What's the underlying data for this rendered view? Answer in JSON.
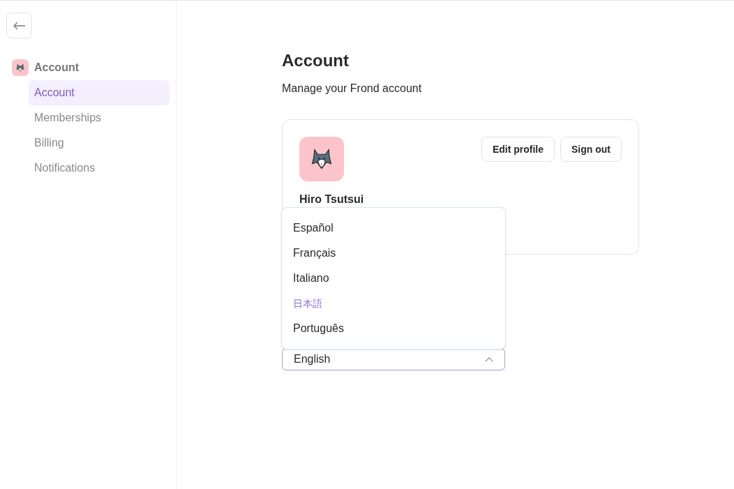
{
  "sidebar": {
    "group": {
      "label": "Account"
    },
    "items": [
      {
        "label": "Account",
        "selected": true
      },
      {
        "label": "Memberships",
        "selected": false
      },
      {
        "label": "Billing",
        "selected": false
      },
      {
        "label": "Notifications",
        "selected": false
      }
    ]
  },
  "page": {
    "title": "Account",
    "subtitle": "Manage your Frond account"
  },
  "profile": {
    "name": "Hiro Tsutsui",
    "buttons": [
      "Edit profile",
      "Sign out"
    ]
  },
  "language_select": {
    "value": "English",
    "expanded": true,
    "options": [
      {
        "label": "Español",
        "highlighted": false
      },
      {
        "label": "Français",
        "highlighted": false
      },
      {
        "label": "Italiano",
        "highlighted": false
      },
      {
        "label": "日本語",
        "highlighted": true
      },
      {
        "label": "Português",
        "highlighted": false
      }
    ]
  }
}
